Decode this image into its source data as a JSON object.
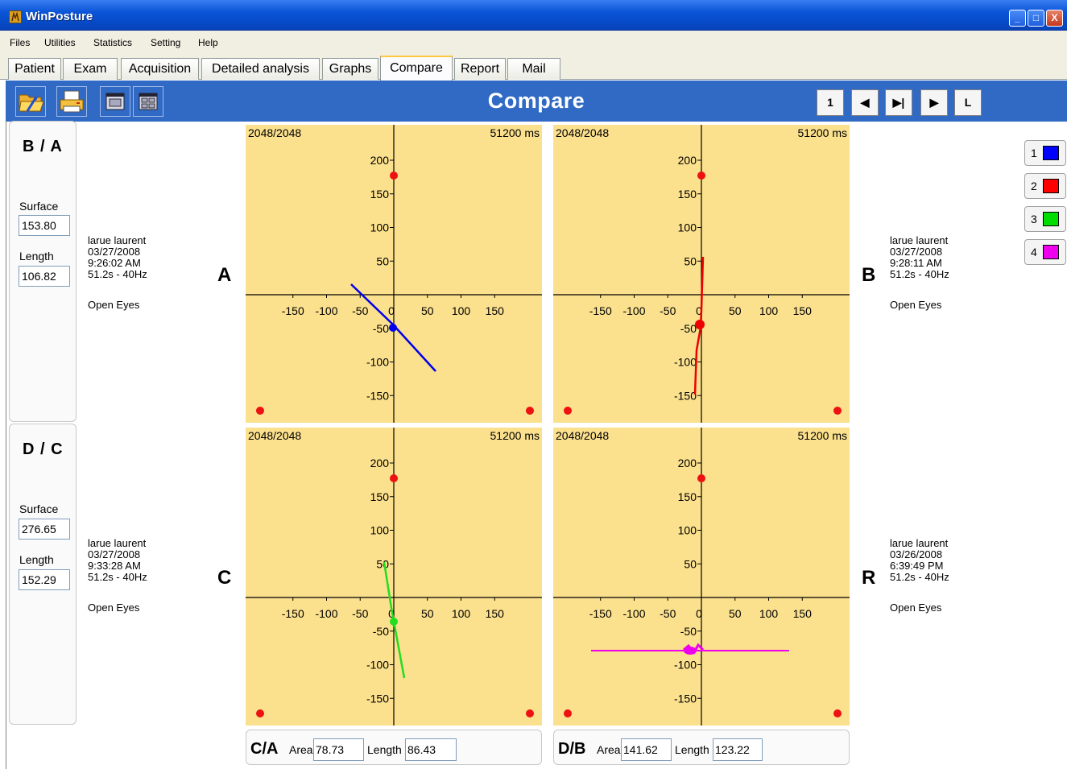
{
  "window": {
    "title": "WinPosture",
    "minimize": "_",
    "maximize": "□",
    "close": "X"
  },
  "menu": [
    "Files",
    "Utilities",
    "Statistics",
    "Setting",
    "Help"
  ],
  "tabs": [
    "Patient",
    "Exam",
    "Acquisition",
    "Detailed analysis",
    "Graphs",
    "Compare",
    "Report",
    "Mail"
  ],
  "active_tab": "Compare",
  "toolbar": {
    "title": "Compare",
    "icons": [
      "open-folder-icon",
      "printer-icon",
      "single-view-icon",
      "quad-view-icon"
    ],
    "nav": [
      "1",
      "◀",
      "▶|",
      "▶",
      "L"
    ]
  },
  "panels": [
    {
      "title": "B / A",
      "surface_label": "Surface",
      "surface": "153.80",
      "length_label": "Length",
      "length": "106.82"
    },
    {
      "title": "D / C",
      "surface_label": "Surface",
      "surface": "276.65",
      "length_label": "Length",
      "length": "152.29"
    }
  ],
  "recordings": [
    {
      "letter": "A",
      "name": "larue laurent",
      "date": "03/27/2008",
      "time": "9:26:02 AM",
      "rate": "51.2s - 40Hz",
      "eyes": "Open Eyes",
      "color": "#0000ee"
    },
    {
      "letter": "B",
      "name": "larue laurent",
      "date": "03/27/2008",
      "time": "9:28:11 AM",
      "rate": "51.2s - 40Hz",
      "eyes": "Open Eyes",
      "color": "#ee0000"
    },
    {
      "letter": "C",
      "name": "larue laurent",
      "date": "03/27/2008",
      "time": "9:33:28 AM",
      "rate": "51.2s - 40Hz",
      "eyes": "Open Eyes",
      "color": "#22dd22"
    },
    {
      "letter": "R",
      "name": "larue laurent",
      "date": "03/26/2008",
      "time": "6:39:49 PM",
      "rate": "51.2s - 40Hz",
      "eyes": "Open Eyes",
      "color": "#ee00ee"
    }
  ],
  "plot_header": {
    "left": "2048/2048",
    "right": "51200 ms"
  },
  "axis_ticks": {
    "y": [
      "200",
      "150",
      "100",
      "50",
      "-50",
      "-100",
      "-150"
    ],
    "x": [
      "-150",
      "-100",
      "-50",
      "0",
      "50",
      "100",
      "150"
    ]
  },
  "legend": [
    {
      "label": "1",
      "color": "#0000ff"
    },
    {
      "label": "2",
      "color": "#ff0000"
    },
    {
      "label": "3",
      "color": "#00dd00"
    },
    {
      "label": "4",
      "color": "#ee00ee"
    }
  ],
  "compare": [
    {
      "label": "C/A",
      "area_label": "Area",
      "area": "78.73",
      "length_label": "Length",
      "length": "86.43"
    },
    {
      "label": "D/B",
      "area_label": "Area",
      "area": "141.62",
      "length_label": "Length",
      "length": "123.22"
    }
  ]
}
